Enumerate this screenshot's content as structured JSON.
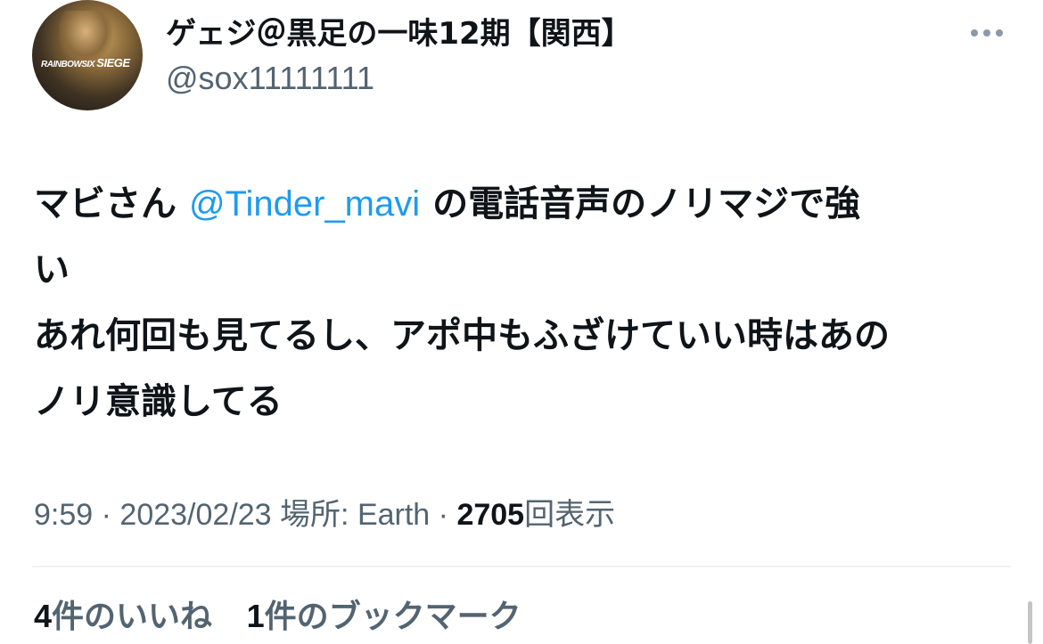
{
  "author": {
    "display_name": "ゲェジ＠黒足の一味12期【関西】",
    "handle": "@sox11111111",
    "avatar_logo_text_a": "RAINBOWSIX",
    "avatar_logo_text_b": "SIEGE"
  },
  "tweet": {
    "text_part1": "マビさん ",
    "mention": "@Tinder_mavi",
    "text_part2": " の電話音声のノリマジで強",
    "line2": "い",
    "line3": "あれ何回も見てるし、アポ中もふざけていい時はあの",
    "line4": "ノリ意識してる"
  },
  "meta": {
    "time": "9:59",
    "date": "2023/02/23",
    "location": "場所: Earth",
    "views_count": "2705",
    "views_label": "回表示",
    "separator": "·"
  },
  "stats": {
    "likes_count": "4",
    "likes_label": "件のいいね",
    "bookmarks_count": "1",
    "bookmarks_label": "件のブックマーク"
  },
  "colors": {
    "mention": "#1d9bf0",
    "secondary_text": "#536471",
    "primary_text": "#0f1419"
  }
}
